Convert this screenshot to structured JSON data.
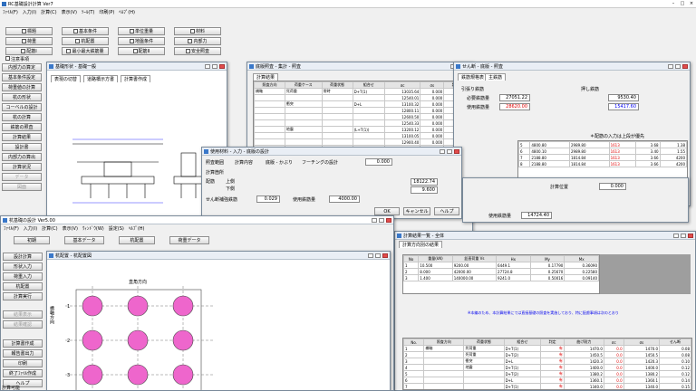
{
  "main": {
    "title": "RC基礎設計計算 Ver7",
    "menu": [
      "ﾌｧｲﾙ(F)",
      "入力(I)",
      "計算(C)",
      "表示(V)",
      "ﾂｰﾙ(T)",
      "印刷(P)",
      "ﾍﾙﾌﾟ(H)"
    ],
    "buttons": [
      "標題",
      "基本条件",
      "単位重量",
      "材料",
      "荷重",
      "杭配置",
      "地盤条件",
      "内部力",
      "配筋I",
      "最小最大鉄筋量",
      "配筋II",
      "安全照査"
    ],
    "check_label": "注意事項",
    "side": [
      "内部力の算定",
      "基本条件設定",
      "荷重値の計算",
      "杭の形状",
      "コーベルの設計",
      "杭の計算",
      "鉄筋の照査",
      "計算結果",
      "設計書",
      "内部力の算出",
      "計算状況",
      "データ",
      "図面",
      "データ保存"
    ]
  },
  "win_drawing": {
    "title": "基礎形状 - 基礎一般",
    "tabs": [
      "表現の切替",
      "道路橋示方書",
      "計算書作成"
    ]
  },
  "win_table": {
    "title": "底版照査 - 集計 - 照査",
    "tab": "計算結果",
    "headers": [
      "照査方向",
      "荷重ケース",
      "荷重状態",
      "組合せ",
      "σc",
      "σs",
      "判定"
    ],
    "rows": [
      [
        "橋軸",
        "死荷重",
        "常時",
        "D+T(1)",
        "13035.64",
        "0.000",
        "0.000"
      ],
      [
        "",
        "",
        "",
        "",
        "12540.01",
        "0.000",
        "0.000"
      ],
      [
        "",
        "衝突",
        "",
        "D+L",
        "13100.32",
        "0.000",
        "0.000"
      ],
      [
        "",
        "",
        "",
        "",
        "12800.11",
        "0.000",
        "0.000"
      ],
      [
        "",
        "",
        "",
        "",
        "12600.50",
        "0.000",
        "0.000"
      ],
      [
        "",
        "",
        "",
        "",
        "12540.33",
        "0.000",
        "0.000"
      ],
      [
        "",
        "地震",
        "",
        "(L+T(1))",
        "13200.12",
        "0.000",
        "0.000"
      ],
      [
        "",
        "",
        "",
        "",
        "13100.05",
        "0.000",
        "0.000"
      ],
      [
        "",
        "",
        "",
        "",
        "12900.40",
        "0.000",
        "0.000"
      ],
      [
        "",
        "",
        "",
        "",
        "12800.21",
        "0.000",
        "0.000"
      ],
      [
        "直角",
        "",
        "",
        "",
        "12700.33",
        "0.000",
        "0.000"
      ],
      [
        "",
        "",
        "",
        "",
        "12600.11",
        "0.000",
        "0.000"
      ]
    ]
  },
  "win_rebar": {
    "title": "せん断 - 底版 - 照査",
    "tabs": [
      "鉄筋規格表",
      "主鉄筋"
    ],
    "top_label": "引張り鉄筋",
    "need_label": "必要鉄筋量",
    "need_val": "27051.22",
    "use_label": "使用鉄筋量",
    "use_val": "28620.00",
    "right_label": "押し鉄筋",
    "r_need": "9530.40",
    "r_use": "15417.60",
    "note": "＊配筋の入力は上段が優先",
    "grid": [
      [
        "5",
        "4800.80",
        "2989.80",
        "1613",
        "3.68",
        "1.38"
      ],
      [
        "6",
        "4800.10",
        "2989.80",
        "1613",
        "3.40",
        "1.55"
      ],
      [
        "7",
        "2188.80",
        "1814.84",
        "1613",
        "3.66",
        "4200"
      ],
      [
        "8",
        "2188.80",
        "1814.84",
        "1613",
        "3.66",
        "4200"
      ]
    ]
  },
  "dialog": {
    "title": "使用材料 - 入力 - 底版の設計",
    "labels": [
      "照査範囲",
      "計算内容",
      "底版 - かぶり",
      "フーチングの設計",
      "計算箇所",
      "配筋",
      "上側",
      "下側",
      "せん断補強鉄筋",
      "使用鉄筋量"
    ],
    "btns": [
      "OK",
      "キャンセル",
      "ヘルプ"
    ],
    "vals": [
      "0.000",
      "0.029",
      "0.300",
      "4000.00",
      "18122.74",
      "9.600"
    ]
  },
  "win_small": {
    "title": "計算位置",
    "val": "0.000",
    "area_label": "使用鉄筋量",
    "area_val": "14724.40"
  },
  "win_result": {
    "title": "計算結果一覧 - 全体",
    "tab": "計算方向別の結果",
    "headers": [
      "No",
      "重量(kN)",
      "鉛直荷重 Vs",
      "Hx",
      "My",
      "Mx"
    ],
    "rows": [
      [
        "1",
        "10.500",
        "9200.00",
        "6449.1",
        "0.17790",
        "0.36090"
      ],
      [
        "2",
        "8.000",
        "42000.00",
        "27724.8",
        "0.25670",
        "0.22580"
      ],
      [
        "3",
        "1.400",
        "140000.00",
        "9241.0",
        "0.50016",
        "0.09140"
      ]
    ],
    "note": "※本編のため、本計算結果にては直接基礎の照査を実施しており、特に配慮事項は次のとおり",
    "lower_headers": [
      "No.",
      "照査方向",
      "荷重状態",
      "荷重状態",
      "組合せ",
      "判定",
      "曲げ耐力",
      "σc",
      "σs",
      "せん断",
      "判定"
    ],
    "lower_rows": [
      [
        "1",
        "橋軸",
        "死荷重",
        "",
        "D+T(1)",
        "有",
        "1470.0",
        "0.0",
        "1470.0",
        "0.08"
      ],
      [
        "2",
        "",
        "死荷重",
        "",
        "D+T(2)",
        "有",
        "1450.5",
        "0.0",
        "1450.5",
        "0.08"
      ],
      [
        "3",
        "",
        "衝突",
        "",
        "D+L",
        "有",
        "1420.3",
        "0.0",
        "1420.3",
        "0.10"
      ],
      [
        "4",
        "",
        "地震",
        "",
        "D+T(1)",
        "有",
        "1400.0",
        "0.0",
        "1400.0",
        "0.12"
      ],
      [
        "5",
        "",
        "",
        "",
        "D+T(2)",
        "有",
        "1380.2",
        "0.0",
        "1380.2",
        "0.12"
      ],
      [
        "6",
        "",
        "",
        "",
        "D+L",
        "有",
        "1360.1",
        "0.0",
        "1360.1",
        "0.14"
      ],
      [
        "7",
        "",
        "",
        "",
        "D+T(1)",
        "有",
        "1340.0",
        "0.0",
        "1340.0",
        "0.15"
      ],
      [
        "8",
        "",
        "",
        "",
        "D+T(2)",
        "有",
        "1320.7",
        "0.0",
        "1320.7",
        "0.15"
      ]
    ]
  },
  "app2": {
    "title": "杭基礎の設計 Ver5.00",
    "menu": [
      "ﾌｧｲﾙ(F)",
      "入力(I)",
      "計算(C)",
      "表示(V)",
      "ｳｨﾝﾄﾞｳ(W)",
      "設定(S)",
      "ﾍﾙﾌﾟ(H)"
    ],
    "toolbar": [
      "初期",
      "基本データ",
      "杭配置",
      "荷重データ"
    ],
    "side": [
      "設計計算",
      "形状入力",
      "荷重入力",
      "杭配置",
      "計算実行",
      "結果表示",
      "結果確認",
      "計算書作成",
      "報告書出力",
      "印刷",
      "終了ﾌｧｲﾙ作成",
      "ヘルプ"
    ],
    "win_title": "杭配置 - 杭配置図",
    "axis_label": "直角方向",
    "left_label": "橋軸方向",
    "row_labels": [
      "1",
      "2",
      "3"
    ],
    "status": "計算可能"
  }
}
